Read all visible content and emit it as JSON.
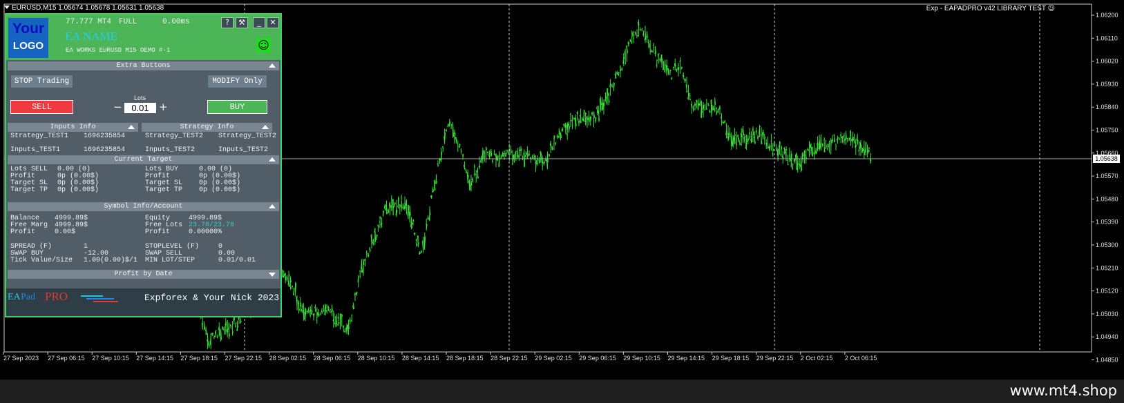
{
  "chart": {
    "symbol_header": "EURUSD,M15  1.05674 1.05678 1.05631 1.05638",
    "ea_label": "Exp - EAPADPRO v42 LIBRARY TEST",
    "current_price": "1.05638",
    "price_axis": [
      "1.06200",
      "1.06110",
      "1.06020",
      "1.05930",
      "1.05840",
      "1.05750",
      "1.05660",
      "1.05570",
      "1.05480",
      "1.05390",
      "1.05300",
      "1.05210",
      "1.05120",
      "1.05030",
      "1.04940",
      "1.04850"
    ],
    "time_axis": [
      "27 Sep 2023",
      "27 Sep 06:15",
      "27 Sep 10:15",
      "27 Sep 14:15",
      "27 Sep 18:15",
      "27 Sep 22:15",
      "28 Sep 02:15",
      "28 Sep 06:15",
      "28 Sep 10:15",
      "28 Sep 14:15",
      "28 Sep 18:15",
      "28 Sep 22:15",
      "29 Sep 02:15",
      "29 Sep 06:15",
      "29 Sep 10:15",
      "29 Sep 14:15",
      "29 Sep 18:15",
      "29 Sep 22:15",
      "2 Oct 02:15",
      "2 Oct 06:15"
    ],
    "colors": {
      "bars": "#33e433",
      "background": "#000000",
      "grid": "#c8c8c8"
    }
  },
  "watermark": "www.mt4.shop",
  "panel": {
    "header": {
      "logo_line1": "Your",
      "logo_line2": "LOGO",
      "version": "77.777 MT4",
      "mode": "FULL",
      "ping": "0.00ms",
      "help_label": "?",
      "minimize_label": "_",
      "close_label": "✕",
      "ea_name": "EA NAME",
      "subtitle": "EA WORKS EURUSD  M15 DEMO    #-1",
      "smiley": "☺"
    },
    "extra_buttons": {
      "title": "Extra Buttons",
      "stop_trading": "STOP Trading",
      "modify_only": "MODIFY Only",
      "sell": "SELL",
      "buy": "BUY",
      "lots_label": "Lots",
      "lots_value": "0.01",
      "minus": "−",
      "plus": "+"
    },
    "inputs_info": {
      "title": "Inputs Info",
      "rows": [
        {
          "k": "Strategy_TEST1",
          "v": "1696235854"
        },
        {
          "k": "Inputs_TEST1",
          "v": "1696235854"
        }
      ]
    },
    "strategy_info": {
      "title": "Strategy Info",
      "rows": [
        {
          "k": "Strategy_TEST2",
          "v": "Strategy_TEST2"
        },
        {
          "k": "Inputs_TEST2",
          "v": "Inputs_TEST2"
        }
      ]
    },
    "current_target": {
      "title": "Current Target",
      "left": [
        {
          "k": "Lots SELL",
          "v": "0.00 (0)"
        },
        {
          "k": "Profit",
          "v": "0p (0.00$)"
        },
        {
          "k": "Target SL",
          "v": "0p (0.00$)"
        },
        {
          "k": "Target TP",
          "v": "0p (0.00$)"
        }
      ],
      "right": [
        {
          "k": "Lots BUY",
          "v": "0.00 (0)"
        },
        {
          "k": "Profit",
          "v": "0p (0.00$)"
        },
        {
          "k": "Target SL",
          "v": "0p (0.00$)"
        },
        {
          "k": "Target TP",
          "v": "0p (0.00$)"
        }
      ]
    },
    "symbol_info": {
      "title": "Symbol Info/Account",
      "left": [
        {
          "k": "Balance",
          "v": "4999.89$"
        },
        {
          "k": "Free Marg",
          "v": "4999.89$"
        },
        {
          "k": "Profit",
          "v": "0.00$"
        }
      ],
      "right": [
        {
          "k": "Equity",
          "v": "4999.89$"
        },
        {
          "k": "Free Lots",
          "v": "23.78/23.78"
        },
        {
          "k": "Profit",
          "v": "0.00000%"
        }
      ],
      "left2": [
        {
          "k": "SPREAD (F)",
          "v": "1"
        },
        {
          "k": "SWAP BUY",
          "v": "-12.00"
        },
        {
          "k": "Tick Value/Size",
          "v": "1.00(0.00)$/1"
        }
      ],
      "right2": [
        {
          "k": "STOPLEVEL (F)",
          "v": "0"
        },
        {
          "k": "SWAP SELL",
          "v": "0.00"
        },
        {
          "k": "MIN LOT/STEP",
          "v": "0.01/0.01"
        }
      ]
    },
    "profit_by_date": {
      "title": "Profit by Date"
    },
    "footer": {
      "brand_ea": "EA",
      "brand_pad": "Pad",
      "brand_pro": "PRO",
      "credit": "Expforex  & Your Nick 2023"
    }
  }
}
